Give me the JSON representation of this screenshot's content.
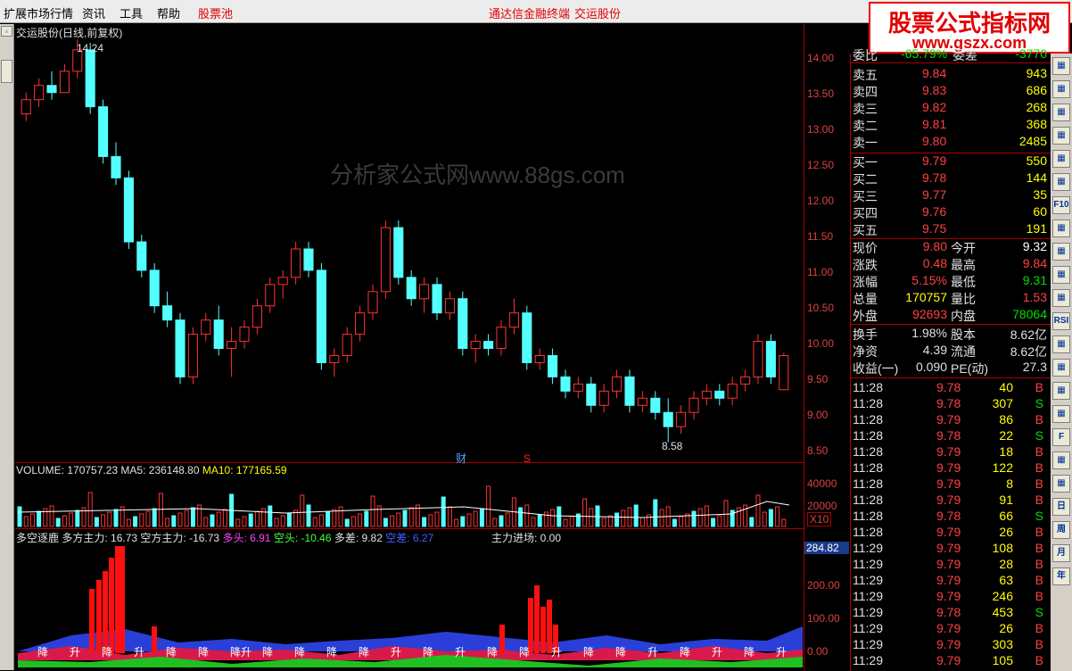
{
  "menu": {
    "items": [
      "扩展市场行情",
      "资讯",
      "工具",
      "帮助",
      "股票池"
    ],
    "center_title": "通达信金融终端",
    "center_stock": "交运股份"
  },
  "logo": {
    "title": "股票公式指标网",
    "url": "www.gszx.com"
  },
  "chart": {
    "title": "交运股份(日线,前复权)",
    "high_label": "14.24",
    "low_label": "8.58",
    "watermark": "分析家公式网www.88gs.com",
    "markers": {
      "cai": "财",
      "s": "S"
    },
    "price_ticks": [
      "14.00",
      "13.50",
      "13.00",
      "12.50",
      "12.00",
      "11.50",
      "11.00",
      "10.50",
      "10.00",
      "9.50",
      "9.00",
      "8.50"
    ],
    "volume_line": {
      "label": "VOLUME: 170757.23",
      "ma5": "MA5: 236148.80",
      "ma10": "MA10: 177165.59"
    },
    "volume_ticks": [
      "40000",
      "20000"
    ],
    "volume_scale": "X10",
    "indicator_line": {
      "name": "多空逐鹿",
      "duo_main": "多方主力: 16.73",
      "kong_main": "空方主力: -16.73",
      "duotou": "多头: 6.91",
      "kongtou": "空头: -10.46",
      "duocha": "多差: 9.82",
      "kongcha": "空差: 6.27",
      "main_entry": "主力进场: 0.00"
    },
    "indicator_ticks": [
      "284.82",
      "200.00",
      "100.00",
      "0.00"
    ],
    "bottom_labels": [
      "降",
      "升",
      "降",
      "升",
      "降",
      "降",
      "降升",
      "降",
      "降",
      "降",
      "降",
      "升",
      "降",
      "升",
      "降",
      "降",
      "升",
      "降",
      "降",
      "升",
      "降",
      "升",
      "降",
      "升"
    ]
  },
  "chart_data": {
    "type": "candlestick",
    "title": "交运股份(日线,前复权)",
    "ylim": [
      8.3,
      14.3
    ],
    "candles": [
      [
        13.2,
        13.5,
        13.1,
        13.4
      ],
      [
        13.4,
        13.7,
        13.3,
        13.6
      ],
      [
        13.6,
        13.8,
        13.4,
        13.5
      ],
      [
        13.5,
        13.9,
        13.5,
        13.8
      ],
      [
        13.8,
        14.24,
        13.7,
        14.1
      ],
      [
        14.1,
        14.2,
        13.2,
        13.3
      ],
      [
        13.3,
        13.4,
        12.5,
        12.6
      ],
      [
        12.6,
        12.8,
        12.2,
        12.3
      ],
      [
        12.3,
        12.4,
        11.3,
        11.4
      ],
      [
        11.4,
        11.5,
        10.9,
        11.0
      ],
      [
        11.0,
        11.1,
        10.4,
        10.5
      ],
      [
        10.5,
        10.7,
        10.2,
        10.3
      ],
      [
        10.3,
        10.4,
        9.4,
        9.5
      ],
      [
        9.5,
        10.2,
        9.4,
        10.1
      ],
      [
        10.1,
        10.4,
        10.0,
        10.3
      ],
      [
        10.3,
        10.5,
        9.8,
        9.9
      ],
      [
        9.9,
        10.2,
        9.5,
        10.0
      ],
      [
        10.0,
        10.3,
        9.9,
        10.2
      ],
      [
        10.2,
        10.6,
        10.1,
        10.5
      ],
      [
        10.5,
        10.9,
        10.4,
        10.8
      ],
      [
        10.8,
        11.0,
        10.6,
        10.9
      ],
      [
        10.9,
        11.4,
        10.8,
        11.3
      ],
      [
        11.3,
        11.4,
        10.9,
        11.0
      ],
      [
        11.0,
        11.1,
        9.6,
        9.7
      ],
      [
        9.7,
        9.9,
        9.5,
        9.8
      ],
      [
        9.8,
        10.2,
        9.7,
        10.1
      ],
      [
        10.1,
        10.5,
        10.0,
        10.4
      ],
      [
        10.4,
        10.8,
        10.3,
        10.7
      ],
      [
        10.7,
        11.7,
        10.6,
        11.6
      ],
      [
        11.6,
        11.7,
        10.8,
        10.9
      ],
      [
        10.9,
        11.0,
        10.5,
        10.6
      ],
      [
        10.6,
        10.9,
        10.4,
        10.8
      ],
      [
        10.8,
        10.9,
        10.3,
        10.4
      ],
      [
        10.4,
        10.7,
        10.3,
        10.6
      ],
      [
        10.6,
        10.7,
        9.8,
        9.9
      ],
      [
        9.9,
        10.1,
        9.7,
        10.0
      ],
      [
        10.0,
        10.1,
        9.8,
        9.9
      ],
      [
        9.9,
        10.3,
        9.8,
        10.2
      ],
      [
        10.2,
        10.6,
        10.1,
        10.4
      ],
      [
        10.4,
        10.5,
        9.6,
        9.7
      ],
      [
        9.7,
        9.9,
        9.6,
        9.8
      ],
      [
        9.8,
        9.9,
        9.4,
        9.5
      ],
      [
        9.5,
        9.6,
        9.2,
        9.3
      ],
      [
        9.3,
        9.5,
        9.2,
        9.4
      ],
      [
        9.4,
        9.5,
        9.0,
        9.1
      ],
      [
        9.1,
        9.4,
        9.0,
        9.3
      ],
      [
        9.3,
        9.6,
        9.2,
        9.5
      ],
      [
        9.5,
        9.6,
        9.0,
        9.1
      ],
      [
        9.1,
        9.3,
        9.0,
        9.2
      ],
      [
        9.2,
        9.3,
        8.9,
        9.0
      ],
      [
        9.0,
        9.2,
        8.58,
        8.8
      ],
      [
        8.8,
        9.1,
        8.7,
        9.0
      ],
      [
        9.0,
        9.3,
        8.9,
        9.2
      ],
      [
        9.2,
        9.4,
        9.1,
        9.3
      ],
      [
        9.3,
        9.4,
        9.1,
        9.2
      ],
      [
        9.2,
        9.5,
        9.1,
        9.4
      ],
      [
        9.4,
        9.6,
        9.3,
        9.5
      ],
      [
        9.5,
        10.1,
        9.4,
        10.0
      ],
      [
        10.0,
        10.1,
        9.4,
        9.5
      ],
      [
        9.32,
        9.84,
        9.31,
        9.8
      ]
    ]
  },
  "quote": {
    "weibi": {
      "label": "委比",
      "value": "-65.79%",
      "label2": "委差",
      "value2": "-3770"
    },
    "sells": [
      {
        "label": "卖五",
        "price": "9.84",
        "vol": "943"
      },
      {
        "label": "卖四",
        "price": "9.83",
        "vol": "686"
      },
      {
        "label": "卖三",
        "price": "9.82",
        "vol": "268"
      },
      {
        "label": "卖二",
        "price": "9.81",
        "vol": "368"
      },
      {
        "label": "卖一",
        "price": "9.80",
        "vol": "2485"
      }
    ],
    "buys": [
      {
        "label": "买一",
        "price": "9.79",
        "vol": "550"
      },
      {
        "label": "买二",
        "price": "9.78",
        "vol": "144"
      },
      {
        "label": "买三",
        "price": "9.77",
        "vol": "35"
      },
      {
        "label": "买四",
        "price": "9.76",
        "vol": "60"
      },
      {
        "label": "买五",
        "price": "9.75",
        "vol": "191"
      }
    ],
    "stats1": [
      {
        "l1": "现价",
        "v1": "9.80",
        "l2": "今开",
        "v2": "9.32",
        "c1": "#ff4040",
        "c2": "#ffffff"
      },
      {
        "l1": "涨跌",
        "v1": "0.48",
        "l2": "最高",
        "v2": "9.84",
        "c1": "#ff4040",
        "c2": "#ff4040"
      },
      {
        "l1": "涨幅",
        "v1": "5.15%",
        "l2": "最低",
        "v2": "9.31",
        "c1": "#ff4040",
        "c2": "#00e000"
      },
      {
        "l1": "总量",
        "v1": "170757",
        "l2": "量比",
        "v2": "1.53",
        "c1": "#ffff00",
        "c2": "#ff4040"
      },
      {
        "l1": "外盘",
        "v1": "92693",
        "l2": "内盘",
        "v2": "78064",
        "c1": "#ff4040",
        "c2": "#00e000"
      }
    ],
    "stats2": [
      {
        "l1": "换手",
        "v1": "1.98%",
        "l2": "股本",
        "v2": "8.62亿"
      },
      {
        "l1": "净资",
        "v1": "4.39",
        "l2": "流通",
        "v2": "8.62亿"
      },
      {
        "l1": "收益(一)",
        "v1": "0.090",
        "l2": "PE(动)",
        "v2": "27.3"
      }
    ],
    "ticks": [
      {
        "t": "11:28",
        "p": "9.78",
        "v": "40",
        "d": "B"
      },
      {
        "t": "11:28",
        "p": "9.78",
        "v": "307",
        "d": "S"
      },
      {
        "t": "11:28",
        "p": "9.79",
        "v": "86",
        "d": "B"
      },
      {
        "t": "11:28",
        "p": "9.78",
        "v": "22",
        "d": "S"
      },
      {
        "t": "11:28",
        "p": "9.79",
        "v": "18",
        "d": "B"
      },
      {
        "t": "11:28",
        "p": "9.79",
        "v": "122",
        "d": "B"
      },
      {
        "t": "11:28",
        "p": "9.79",
        "v": "8",
        "d": "B"
      },
      {
        "t": "11:28",
        "p": "9.79",
        "v": "91",
        "d": "B"
      },
      {
        "t": "11:28",
        "p": "9.78",
        "v": "66",
        "d": "S"
      },
      {
        "t": "11:28",
        "p": "9.79",
        "v": "26",
        "d": "B"
      },
      {
        "t": "11:29",
        "p": "9.79",
        "v": "108",
        "d": "B"
      },
      {
        "t": "11:29",
        "p": "9.79",
        "v": "28",
        "d": "B"
      },
      {
        "t": "11:29",
        "p": "9.79",
        "v": "63",
        "d": "B"
      },
      {
        "t": "11:29",
        "p": "9.79",
        "v": "246",
        "d": "B"
      },
      {
        "t": "11:29",
        "p": "9.78",
        "v": "453",
        "d": "S"
      },
      {
        "t": "11:29",
        "p": "9.79",
        "v": "26",
        "d": "B"
      },
      {
        "t": "11:29",
        "p": "9.79",
        "v": "303",
        "d": "B"
      },
      {
        "t": "11:29",
        "p": "9.79",
        "v": "105",
        "d": "B"
      }
    ]
  },
  "toolbar": {
    "buttons": [
      "grid-icon",
      "chart-icon",
      "list-icon",
      "candle-icon",
      "line-icon",
      "cross-icon",
      "F10",
      "table-icon",
      "info-icon",
      "bar-icon",
      "chart2-icon",
      "RSI",
      "flag-icon",
      "move-icon",
      "up-icon",
      "down-icon",
      "F",
      "refresh-icon",
      "book-icon",
      "日",
      "周",
      "月",
      "年"
    ]
  }
}
